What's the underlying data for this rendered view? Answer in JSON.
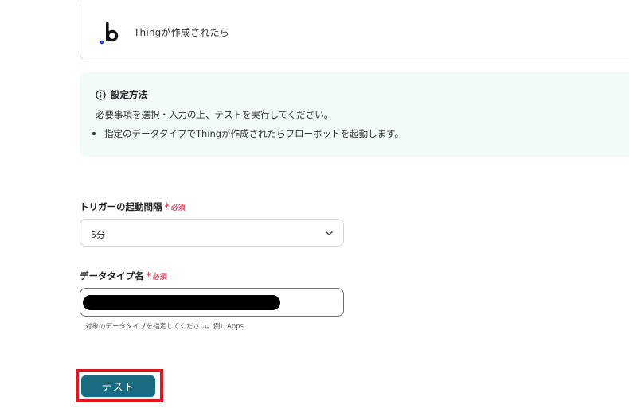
{
  "trigger": {
    "title": "Thingが作成されたら",
    "app_icon": "b-logo-icon"
  },
  "info": {
    "icon": "info-circle-icon",
    "title": "設定方法",
    "description": "必要事項を選択・入力の上、テストを実行してください。",
    "bullets": [
      "指定のデータタイプでThingが作成されたらフローボットを起動します。"
    ]
  },
  "form": {
    "interval": {
      "label": "トリガーの起動間隔",
      "required_mark": "*",
      "required_text": "必須",
      "value": "5分",
      "icon": "chevron-down-icon"
    },
    "data_type": {
      "label": "データタイプ名",
      "required_mark": "*",
      "required_text": "必須",
      "value_redacted": true,
      "hint": "対象のデータタイプを指定してください。例）Apps"
    }
  },
  "actions": {
    "test_label": "テスト"
  },
  "colors": {
    "accent": "#186b80",
    "required": "#e64a5f",
    "highlight": "#e3141f",
    "info_bg": "#f2fbfa"
  }
}
